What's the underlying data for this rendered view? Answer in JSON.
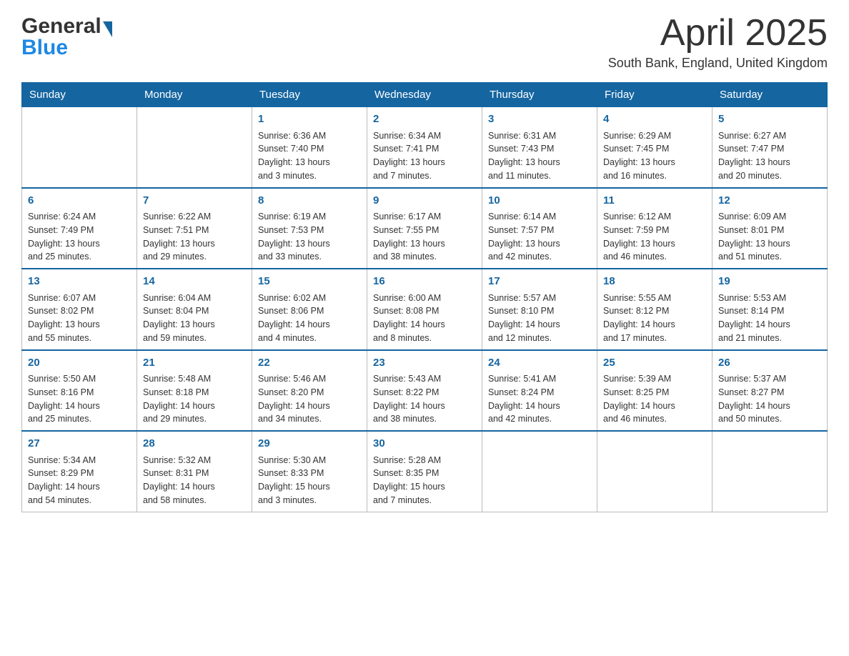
{
  "header": {
    "logo": {
      "general": "General",
      "blue": "Blue",
      "triangle_color": "#1565a0"
    },
    "title": "April 2025",
    "location": "South Bank, England, United Kingdom"
  },
  "calendar": {
    "days_of_week": [
      "Sunday",
      "Monday",
      "Tuesday",
      "Wednesday",
      "Thursday",
      "Friday",
      "Saturday"
    ],
    "weeks": [
      [
        {
          "day": "",
          "info": ""
        },
        {
          "day": "",
          "info": ""
        },
        {
          "day": "1",
          "info": "Sunrise: 6:36 AM\nSunset: 7:40 PM\nDaylight: 13 hours\nand 3 minutes."
        },
        {
          "day": "2",
          "info": "Sunrise: 6:34 AM\nSunset: 7:41 PM\nDaylight: 13 hours\nand 7 minutes."
        },
        {
          "day": "3",
          "info": "Sunrise: 6:31 AM\nSunset: 7:43 PM\nDaylight: 13 hours\nand 11 minutes."
        },
        {
          "day": "4",
          "info": "Sunrise: 6:29 AM\nSunset: 7:45 PM\nDaylight: 13 hours\nand 16 minutes."
        },
        {
          "day": "5",
          "info": "Sunrise: 6:27 AM\nSunset: 7:47 PM\nDaylight: 13 hours\nand 20 minutes."
        }
      ],
      [
        {
          "day": "6",
          "info": "Sunrise: 6:24 AM\nSunset: 7:49 PM\nDaylight: 13 hours\nand 25 minutes."
        },
        {
          "day": "7",
          "info": "Sunrise: 6:22 AM\nSunset: 7:51 PM\nDaylight: 13 hours\nand 29 minutes."
        },
        {
          "day": "8",
          "info": "Sunrise: 6:19 AM\nSunset: 7:53 PM\nDaylight: 13 hours\nand 33 minutes."
        },
        {
          "day": "9",
          "info": "Sunrise: 6:17 AM\nSunset: 7:55 PM\nDaylight: 13 hours\nand 38 minutes."
        },
        {
          "day": "10",
          "info": "Sunrise: 6:14 AM\nSunset: 7:57 PM\nDaylight: 13 hours\nand 42 minutes."
        },
        {
          "day": "11",
          "info": "Sunrise: 6:12 AM\nSunset: 7:59 PM\nDaylight: 13 hours\nand 46 minutes."
        },
        {
          "day": "12",
          "info": "Sunrise: 6:09 AM\nSunset: 8:01 PM\nDaylight: 13 hours\nand 51 minutes."
        }
      ],
      [
        {
          "day": "13",
          "info": "Sunrise: 6:07 AM\nSunset: 8:02 PM\nDaylight: 13 hours\nand 55 minutes."
        },
        {
          "day": "14",
          "info": "Sunrise: 6:04 AM\nSunset: 8:04 PM\nDaylight: 13 hours\nand 59 minutes."
        },
        {
          "day": "15",
          "info": "Sunrise: 6:02 AM\nSunset: 8:06 PM\nDaylight: 14 hours\nand 4 minutes."
        },
        {
          "day": "16",
          "info": "Sunrise: 6:00 AM\nSunset: 8:08 PM\nDaylight: 14 hours\nand 8 minutes."
        },
        {
          "day": "17",
          "info": "Sunrise: 5:57 AM\nSunset: 8:10 PM\nDaylight: 14 hours\nand 12 minutes."
        },
        {
          "day": "18",
          "info": "Sunrise: 5:55 AM\nSunset: 8:12 PM\nDaylight: 14 hours\nand 17 minutes."
        },
        {
          "day": "19",
          "info": "Sunrise: 5:53 AM\nSunset: 8:14 PM\nDaylight: 14 hours\nand 21 minutes."
        }
      ],
      [
        {
          "day": "20",
          "info": "Sunrise: 5:50 AM\nSunset: 8:16 PM\nDaylight: 14 hours\nand 25 minutes."
        },
        {
          "day": "21",
          "info": "Sunrise: 5:48 AM\nSunset: 8:18 PM\nDaylight: 14 hours\nand 29 minutes."
        },
        {
          "day": "22",
          "info": "Sunrise: 5:46 AM\nSunset: 8:20 PM\nDaylight: 14 hours\nand 34 minutes."
        },
        {
          "day": "23",
          "info": "Sunrise: 5:43 AM\nSunset: 8:22 PM\nDaylight: 14 hours\nand 38 minutes."
        },
        {
          "day": "24",
          "info": "Sunrise: 5:41 AM\nSunset: 8:24 PM\nDaylight: 14 hours\nand 42 minutes."
        },
        {
          "day": "25",
          "info": "Sunrise: 5:39 AM\nSunset: 8:25 PM\nDaylight: 14 hours\nand 46 minutes."
        },
        {
          "day": "26",
          "info": "Sunrise: 5:37 AM\nSunset: 8:27 PM\nDaylight: 14 hours\nand 50 minutes."
        }
      ],
      [
        {
          "day": "27",
          "info": "Sunrise: 5:34 AM\nSunset: 8:29 PM\nDaylight: 14 hours\nand 54 minutes."
        },
        {
          "day": "28",
          "info": "Sunrise: 5:32 AM\nSunset: 8:31 PM\nDaylight: 14 hours\nand 58 minutes."
        },
        {
          "day": "29",
          "info": "Sunrise: 5:30 AM\nSunset: 8:33 PM\nDaylight: 15 hours\nand 3 minutes."
        },
        {
          "day": "30",
          "info": "Sunrise: 5:28 AM\nSunset: 8:35 PM\nDaylight: 15 hours\nand 7 minutes."
        },
        {
          "day": "",
          "info": ""
        },
        {
          "day": "",
          "info": ""
        },
        {
          "day": "",
          "info": ""
        }
      ]
    ]
  }
}
